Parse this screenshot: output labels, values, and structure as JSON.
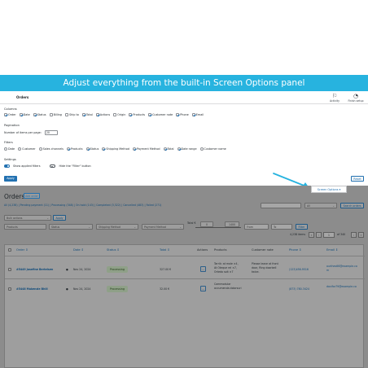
{
  "banner": {
    "text": "Adjust everything from the built-in Screen Options panel"
  },
  "topbar": {
    "title": "Orders",
    "activity": {
      "label": "Activity",
      "icon": "activity-icon"
    },
    "finish_setup": {
      "label": "Finish setup",
      "icon": "progress-icon"
    }
  },
  "screen_options": {
    "columns_heading": "Columns",
    "columns": [
      {
        "label": "Order",
        "checked": true
      },
      {
        "label": "Date",
        "checked": true
      },
      {
        "label": "Status",
        "checked": true
      },
      {
        "label": "Billing",
        "checked": false
      },
      {
        "label": "Ship to",
        "checked": false
      },
      {
        "label": "Total",
        "checked": true
      },
      {
        "label": "Actions",
        "checked": true
      },
      {
        "label": "Origin",
        "checked": false
      },
      {
        "label": "Products",
        "checked": true
      },
      {
        "label": "Customer note",
        "checked": true
      },
      {
        "label": "Phone",
        "checked": true
      },
      {
        "label": "Email",
        "checked": true
      }
    ],
    "pagination_heading": "Pagination",
    "items_per_page_label": "Number of items per page:",
    "items_per_page_value": "20",
    "filters_heading": "Filters",
    "filters": [
      {
        "label": "Date",
        "checked": false
      },
      {
        "label": "Customer",
        "checked": false
      },
      {
        "label": "Sales channels",
        "checked": false
      },
      {
        "label": "Products",
        "checked": true
      },
      {
        "label": "Status",
        "checked": true
      },
      {
        "label": "Shipping Method",
        "checked": true
      },
      {
        "label": "Payment Method",
        "checked": true
      },
      {
        "label": "Total",
        "checked": true
      },
      {
        "label": "Date range",
        "checked": true
      },
      {
        "label": "Customer name",
        "checked": false
      }
    ],
    "settings_heading": "Settings",
    "show_applied_filters": "Show applied filters",
    "hide_filter_button": "Hide the \"Filter\" button",
    "apply_label": "Apply",
    "reset_label": "Reset"
  },
  "screen_options_tab": "Screen Options ▾",
  "orders": {
    "title": "Orders",
    "add_order": "Add order",
    "subsubsub": "All (4,238) | Pending payment (11) | Processing (348) | On hold (143) | Completed (3,322) | Cancelled (483) | Failed (271)",
    "all_select": "All",
    "search_button": "Search orders",
    "bulk_actions": "Bulk actions",
    "apply_label": "Apply",
    "filters": {
      "products": "Products",
      "status": "Status",
      "shipping": "Shipping Method",
      "payment": "Payment Method",
      "total_label": "Total €",
      "total_min": "0",
      "total_max": "1400",
      "from": "From",
      "to": "To",
      "filter_button": "Filter"
    },
    "pagination": {
      "items": "4,238 items",
      "first": "«",
      "prev": "‹",
      "current": "1",
      "of": "of 340",
      "next": "›",
      "last": "»"
    },
    "headers": {
      "order": "Order ⇕",
      "date": "Date ⇕",
      "status": "Status ⇕",
      "total": "Total ⇕",
      "actions": "Actions",
      "products": "Products",
      "note": "Customer note",
      "phone": "Phone ⇕",
      "email": "Email ⇕"
    },
    "rows": [
      {
        "order": "#5449 Josefine Bertelsen",
        "date": "Nov 24, 2024",
        "status": "Processing",
        "total": "327.00 €",
        "action": "…",
        "products": [
          "Tarrik: at mole ×4,",
          "At Oteque rel ×7,",
          "Ortedo soit ×7"
        ],
        "note": [
          "Please leave at front",
          "door, Ring doorbell",
          "twice."
        ],
        "phone": "(123)456-9516",
        "email": [
          "aurthes66@example.co",
          "m"
        ]
      },
      {
        "order": "#5448 Makenzie Bhill",
        "date": "Nov 24, 2024",
        "status": "Processing",
        "total": "32.00 €",
        "action": "…",
        "products": [
          "Commodular",
          "accumenda dolorsuri"
        ],
        "note": [],
        "phone": "(873) 780-3424",
        "email": [
          "davifar79@example.co"
        ]
      }
    ]
  },
  "colors": {
    "banner": "#27b3df",
    "accent": "#2271b1",
    "overlay": "#8c8c8c"
  }
}
